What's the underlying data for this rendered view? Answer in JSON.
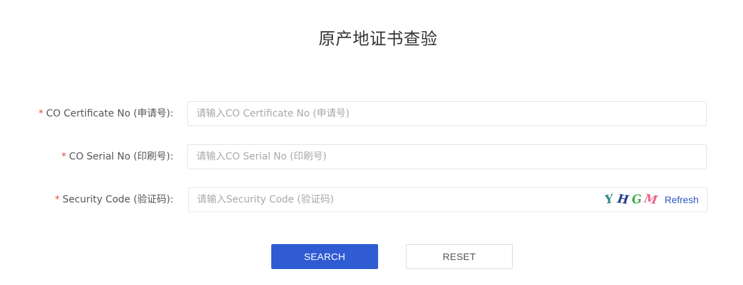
{
  "page": {
    "title": "原产地证书查验"
  },
  "form": {
    "required_mark": "*",
    "fields": [
      {
        "label": "CO Certificate No (申请号):",
        "placeholder": "请输入CO Certificate No (申请号)",
        "value": ""
      },
      {
        "label": "CO Serial No (印刷号):",
        "placeholder": "请输入CO Serial No (印刷号)",
        "value": ""
      },
      {
        "label": "Security Code (验证码):",
        "placeholder": "请输入Security Code (验证码)",
        "value": ""
      }
    ],
    "captcha": {
      "chars": [
        "Y",
        "H",
        "G",
        "M"
      ],
      "refresh_label": "Refresh"
    }
  },
  "buttons": {
    "search_label": "SEARCH",
    "reset_label": "RESET"
  },
  "colors": {
    "primary": "#2f5bd3",
    "required": "#e74c3c",
    "link": "#2b56c6"
  }
}
